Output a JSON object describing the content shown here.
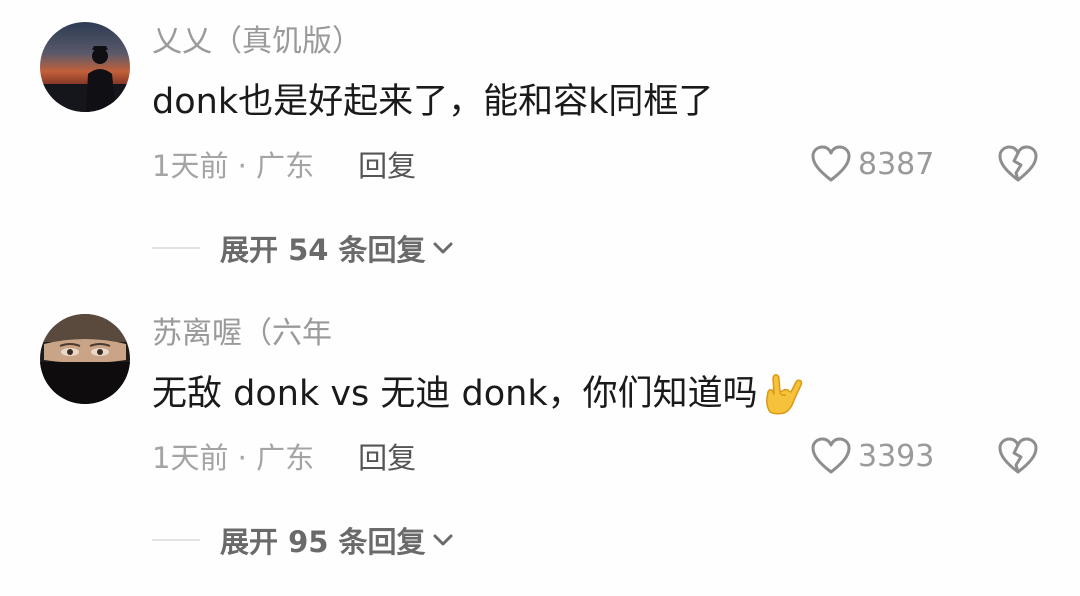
{
  "comments": [
    {
      "username": "乂乂（真饥版）",
      "text": "donk也是好起来了，能和容k同框了",
      "emoji": "",
      "time_location": "1天前 · 广东",
      "reply_label": "回复",
      "like_count": "8387",
      "expand_label": "展开 54 条回复"
    },
    {
      "username": "苏离喔（六年",
      "text": "无敌 donk vs 无迪 donk，你们知道吗",
      "emoji": "🤟",
      "time_location": "1天前 · 广东",
      "reply_label": "回复",
      "like_count": "3393",
      "expand_label": "展开 95 条回复"
    }
  ],
  "icons": {
    "like": "heart-outline-icon",
    "dislike": "broken-heart-icon",
    "expand": "chevron-down-icon",
    "emoji": "love-you-gesture-icon"
  },
  "colors": {
    "username": "#9a9a9a",
    "text": "#1a1a1a",
    "meta": "#a4a4a4",
    "expand": "#6a6a6a"
  }
}
